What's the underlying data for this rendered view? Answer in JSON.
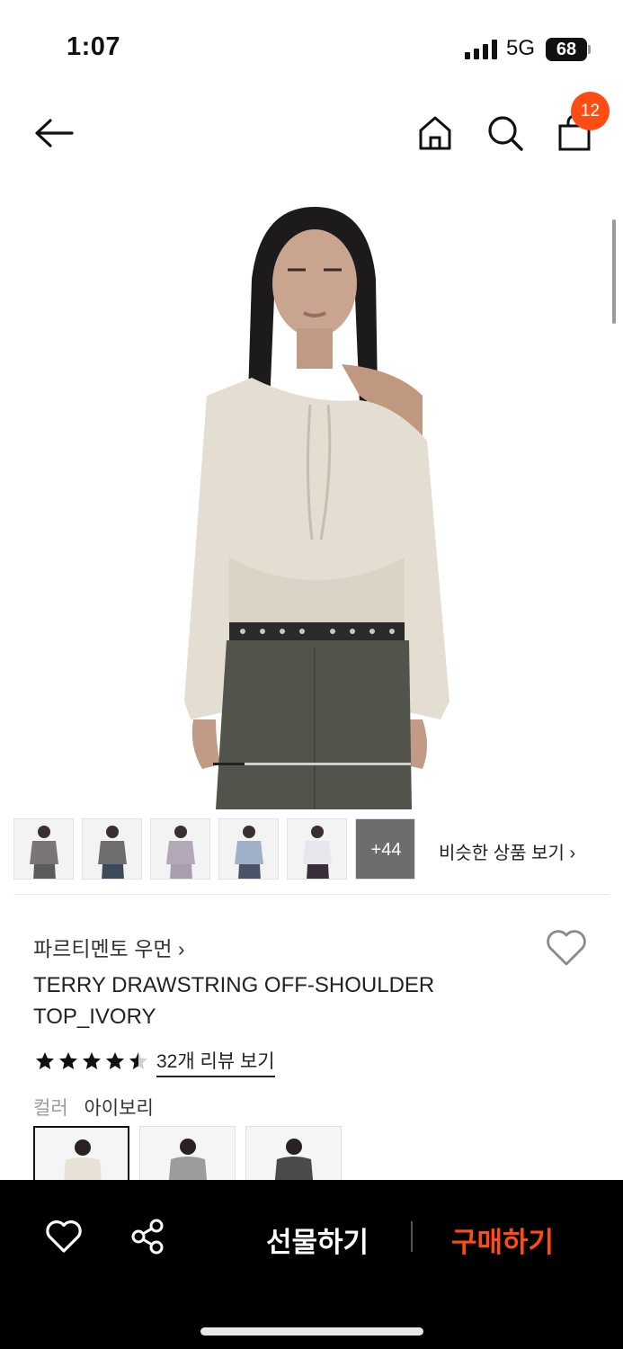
{
  "status_bar": {
    "time": "1:07",
    "network": "5G",
    "battery": "68"
  },
  "header": {
    "icons": [
      "back-arrow-icon",
      "home-icon",
      "search-icon",
      "shopping-bag-icon"
    ],
    "cart_count": "12"
  },
  "gallery": {
    "progress_fraction": 0.16,
    "thumbnails": [
      {
        "top_color": "#7a7678",
        "bottom_color": "#5e5b5c"
      },
      {
        "top_color": "#6f6d70",
        "bottom_color": "#3d4a5a"
      },
      {
        "top_color": "#b2a8b8",
        "bottom_color": "#a99db0"
      },
      {
        "top_color": "#9fb0c8",
        "bottom_color": "#4a5468"
      },
      {
        "top_color": "#e6e6ec",
        "bottom_color": "#3a2d3a"
      }
    ],
    "more_count": "+44",
    "similar_label": "비슷한 상품 보기 ›"
  },
  "product": {
    "brand": "파르티멘토 우먼 ›",
    "name": "TERRY DRAWSTRING OFF-SHOULDER TOP_IVORY",
    "rating": 4.5,
    "review_link": "32개 리뷰 보기",
    "color_label": "컬러",
    "color_value": "아이보리",
    "swatches": [
      {
        "name": "ivory",
        "color": "#e8e2d6",
        "selected": true
      },
      {
        "name": "gray",
        "color": "#9c9c9e",
        "selected": false
      },
      {
        "name": "charcoal",
        "color": "#4a4a4c",
        "selected": false
      }
    ]
  },
  "bottom_bar": {
    "gift_label": "선물하기",
    "buy_label": "구매하기",
    "accent_color": "#ff4b14"
  }
}
